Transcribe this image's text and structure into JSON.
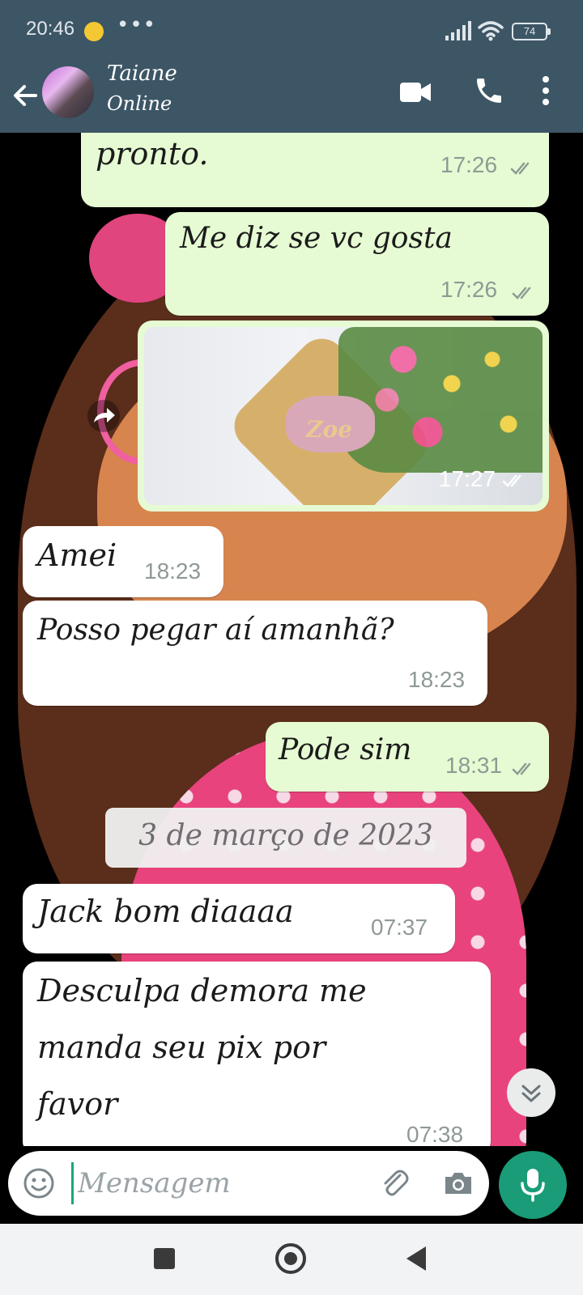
{
  "status_bar": {
    "time": "20:46",
    "extra_indicator": "•••",
    "battery": "74"
  },
  "header": {
    "contact_name": "Taiane",
    "contact_status": "Online",
    "icons": [
      "back-arrow-icon",
      "video-camera-icon",
      "phone-icon",
      "more-vertical-icon"
    ]
  },
  "messages": [
    {
      "direction": "out",
      "text": "pronto.",
      "time": "17:26",
      "status": "read"
    },
    {
      "direction": "out",
      "text": "Me diz se vc gosta",
      "time": "17:26",
      "status": "read"
    },
    {
      "direction": "out",
      "type": "image",
      "image_text": "Zoe",
      "time": "17:27",
      "status": "read"
    },
    {
      "direction": "in",
      "text": "Amei",
      "time": "18:23"
    },
    {
      "direction": "in",
      "text": "Posso pegar aí amanhã?",
      "time": "18:23"
    },
    {
      "direction": "out",
      "text": "Pode sim",
      "time": "18:31",
      "status": "read"
    },
    {
      "direction": "in",
      "text": "Jack bom diaaaa",
      "time": "07:37"
    },
    {
      "direction": "in",
      "text_lines": [
        "Desculpa demora me",
        "manda seu pix por",
        "favor"
      ],
      "time": "07:38"
    }
  ],
  "date_separator": "3 de março de 2023",
  "composer": {
    "placeholder": "Mensagem",
    "icons": [
      "emoji-icon",
      "paperclip-icon",
      "camera-icon",
      "microphone-icon"
    ]
  },
  "colors": {
    "header": "#3d5666",
    "outgoing_bubble": "#e6fbd3",
    "incoming_bubble": "#ffffff",
    "mic_button": "#1a9c78",
    "read_ticks": "#8f9a94"
  }
}
